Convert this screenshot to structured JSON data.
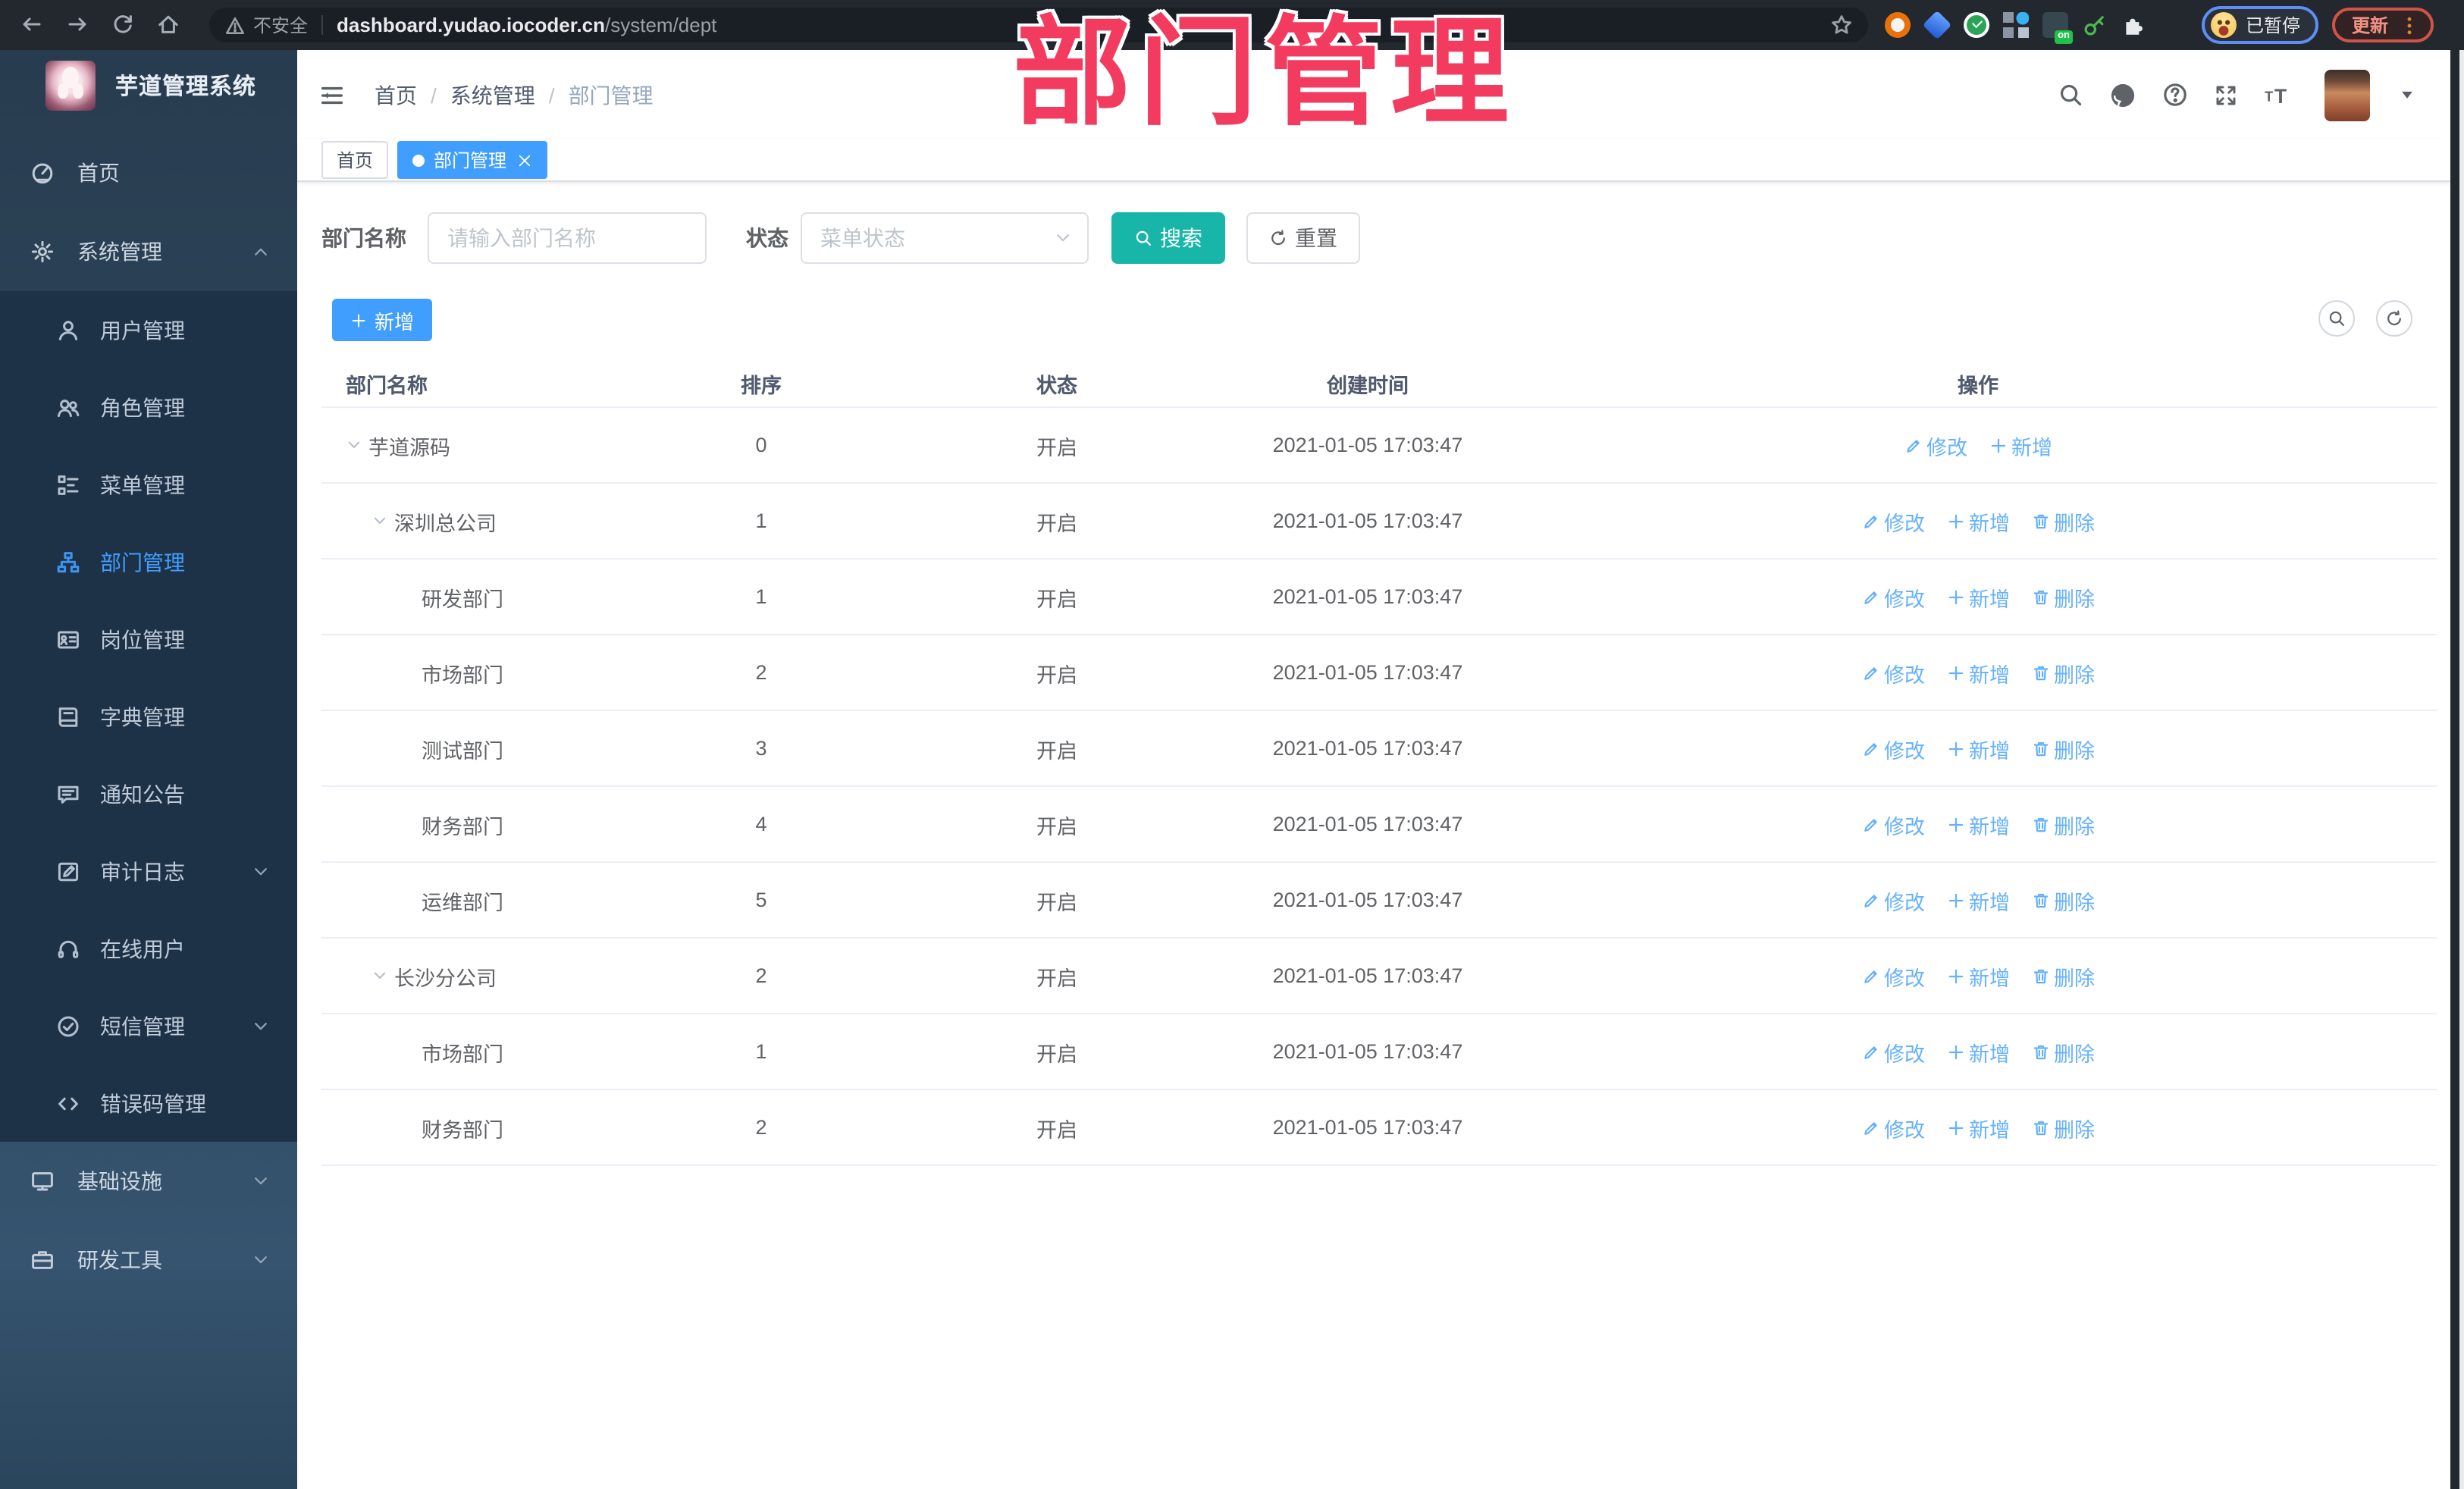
{
  "overlay_title": "部门管理",
  "browser": {
    "security_label": "不安全",
    "url_host": "dashboard.yudao.iocoder.cn",
    "url_path": "/system/dept",
    "ext_badge": "on",
    "profile_status": "已暂停",
    "update_label": "更新"
  },
  "sidebar": {
    "app_title": "芋道管理系统",
    "items": [
      {
        "name": "home",
        "label": "首页",
        "icon": "dashboard-icon",
        "kind": "top"
      },
      {
        "name": "system-management",
        "label": "系统管理",
        "icon": "gear-icon",
        "kind": "top",
        "chevron": "up"
      },
      {
        "name": "user-management",
        "label": "用户管理",
        "icon": "user-icon",
        "kind": "sub"
      },
      {
        "name": "role-management",
        "label": "角色管理",
        "icon": "users-icon",
        "kind": "sub"
      },
      {
        "name": "menu-management",
        "label": "菜单管理",
        "icon": "menu-tree-icon",
        "kind": "sub"
      },
      {
        "name": "dept-management",
        "label": "部门管理",
        "icon": "sitemap-icon",
        "kind": "sub",
        "active": true
      },
      {
        "name": "post-management",
        "label": "岗位管理",
        "icon": "id-card-icon",
        "kind": "sub"
      },
      {
        "name": "dict-management",
        "label": "字典管理",
        "icon": "book-icon",
        "kind": "sub"
      },
      {
        "name": "notice-management",
        "label": "通知公告",
        "icon": "comment-icon",
        "kind": "sub"
      },
      {
        "name": "audit-log",
        "label": "审计日志",
        "icon": "edit-log-icon",
        "kind": "sub",
        "chevron": "down"
      },
      {
        "name": "online-users",
        "label": "在线用户",
        "icon": "headset-icon",
        "kind": "sub"
      },
      {
        "name": "sms-management",
        "label": "短信管理",
        "icon": "check-circle-icon",
        "kind": "sub",
        "chevron": "down"
      },
      {
        "name": "error-code-management",
        "label": "错误码管理",
        "icon": "code-icon",
        "kind": "sub"
      },
      {
        "name": "infrastructure",
        "label": "基础设施",
        "icon": "monitor-icon",
        "kind": "top",
        "chevron": "down"
      },
      {
        "name": "dev-tools",
        "label": "研发工具",
        "icon": "briefcase-icon",
        "kind": "top",
        "chevron": "down"
      }
    ]
  },
  "header": {
    "breadcrumb": [
      "首页",
      "系统管理",
      "部门管理"
    ]
  },
  "tabs": [
    {
      "label": "首页",
      "active": false
    },
    {
      "label": "部门管理",
      "active": true,
      "closable": true
    }
  ],
  "filters": {
    "dept_label": "部门名称",
    "dept_placeholder": "请输入部门名称",
    "status_label": "状态",
    "status_placeholder": "菜单状态",
    "search_label": "搜索",
    "reset_label": "重置"
  },
  "toolbar": {
    "add_label": "新增"
  },
  "table": {
    "columns": [
      "部门名称",
      "排序",
      "状态",
      "创建时间",
      "操作"
    ],
    "action_labels": {
      "modify": "修改",
      "add": "新增",
      "delete": "删除"
    },
    "rows": [
      {
        "name": "芋道源码",
        "level": 0,
        "expandable": true,
        "sort": "0",
        "status": "开启",
        "created": "2021-01-05 17:03:47",
        "actions": [
          "modify",
          "add"
        ]
      },
      {
        "name": "深圳总公司",
        "level": 1,
        "expandable": true,
        "sort": "1",
        "status": "开启",
        "created": "2021-01-05 17:03:47",
        "actions": [
          "modify",
          "add",
          "delete"
        ]
      },
      {
        "name": "研发部门",
        "level": 2,
        "expandable": false,
        "sort": "1",
        "status": "开启",
        "created": "2021-01-05 17:03:47",
        "actions": [
          "modify",
          "add",
          "delete"
        ]
      },
      {
        "name": "市场部门",
        "level": 2,
        "expandable": false,
        "sort": "2",
        "status": "开启",
        "created": "2021-01-05 17:03:47",
        "actions": [
          "modify",
          "add",
          "delete"
        ]
      },
      {
        "name": "测试部门",
        "level": 2,
        "expandable": false,
        "sort": "3",
        "status": "开启",
        "created": "2021-01-05 17:03:47",
        "actions": [
          "modify",
          "add",
          "delete"
        ]
      },
      {
        "name": "财务部门",
        "level": 2,
        "expandable": false,
        "sort": "4",
        "status": "开启",
        "created": "2021-01-05 17:03:47",
        "actions": [
          "modify",
          "add",
          "delete"
        ]
      },
      {
        "name": "运维部门",
        "level": 2,
        "expandable": false,
        "sort": "5",
        "status": "开启",
        "created": "2021-01-05 17:03:47",
        "actions": [
          "modify",
          "add",
          "delete"
        ]
      },
      {
        "name": "长沙分公司",
        "level": 1,
        "expandable": true,
        "sort": "2",
        "status": "开启",
        "created": "2021-01-05 17:03:47",
        "actions": [
          "modify",
          "add",
          "delete"
        ]
      },
      {
        "name": "市场部门",
        "level": 2,
        "expandable": false,
        "sort": "1",
        "status": "开启",
        "created": "2021-01-05 17:03:47",
        "actions": [
          "modify",
          "add",
          "delete"
        ]
      },
      {
        "name": "财务部门",
        "level": 2,
        "expandable": false,
        "sort": "2",
        "status": "开启",
        "created": "2021-01-05 17:03:47",
        "actions": [
          "modify",
          "add",
          "delete"
        ]
      }
    ]
  },
  "colors": {
    "accent": "#409eff",
    "link": "#66b1ff",
    "search_button": "#18b6a8",
    "overlay_title": "#f23b5f",
    "sidebar_bg": "#2e4a61",
    "submenu_bg": "#1e3247",
    "active_menu_text": "#409eff",
    "tab_active_bg": "#409eff",
    "paused_ring": "#5e8df6",
    "update_ring": "#cf5447"
  }
}
